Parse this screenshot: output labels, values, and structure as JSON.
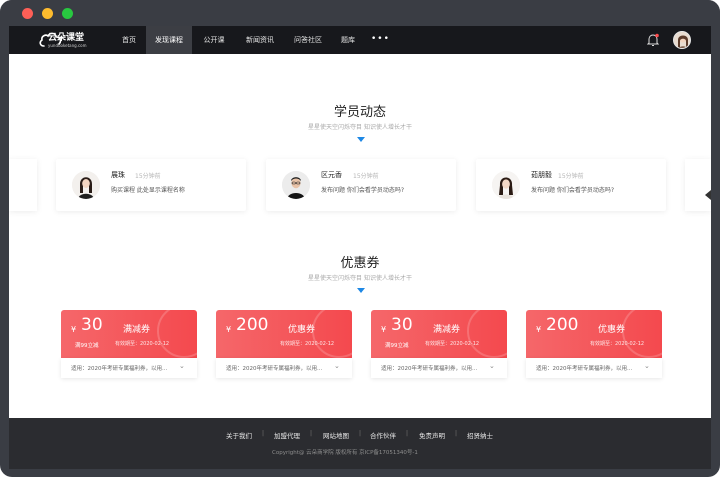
{
  "nav": {
    "logo_name": "云朵课堂",
    "logo_sub": "yunduoketang.com",
    "items": [
      "首页",
      "发现课程",
      "公开课",
      "新闻资讯",
      "问答社区",
      "题库"
    ],
    "more": "•••"
  },
  "activity": {
    "title": "学员动态",
    "subtitle": "星星使天空闪烁夺目  知识使人增长才干",
    "cards": [
      {
        "name": "展珠",
        "time": "15分钟前",
        "desc": "购买课程  此处显示课程名称"
      },
      {
        "name": "区元香",
        "time": "15分钟前",
        "desc": "发布问题  你们会看学员动态吗?"
      },
      {
        "name": "茹朋毅",
        "time": "15分钟前",
        "desc": "发布问题  你们会看学员动态吗?"
      }
    ]
  },
  "coupons": {
    "title": "优惠券",
    "subtitle": "星星使天空闪烁夺目  知识使人增长才干",
    "items": [
      {
        "yen": "¥",
        "amount": "30",
        "kind": "满减券",
        "condition": "满99立减",
        "valid": "有效期至：2020-02-12",
        "apply": "适用：2020年考研专属福利券，以用..."
      },
      {
        "yen": "¥",
        "amount": "200",
        "kind": "优惠券",
        "condition": "",
        "valid": "有效期至：2020-02-12",
        "apply": "适用：2020年考研专属福利券，以用..."
      },
      {
        "yen": "¥",
        "amount": "30",
        "kind": "满减券",
        "condition": "满99立减",
        "valid": "有效期至：2020-02-12",
        "apply": "适用：2020年考研专属福利券，以用..."
      },
      {
        "yen": "¥",
        "amount": "200",
        "kind": "优惠券",
        "condition": "",
        "valid": "有效期至：2020-02-12",
        "apply": "适用：2020年考研专属福利券，以用..."
      }
    ]
  },
  "footer": {
    "links": [
      "关于我们",
      "加盟代理",
      "网站地图",
      "合作伙伴",
      "免责声明",
      "招贤纳士"
    ],
    "copyright": "Copyright@  云朵商学院   版权所有      京ICP备17051340号-1"
  },
  "colors": {
    "accent": "#1e88e5",
    "coupon": "#f4494e",
    "nav_bg": "#17181c",
    "footer_bg": "#2b2c30"
  }
}
